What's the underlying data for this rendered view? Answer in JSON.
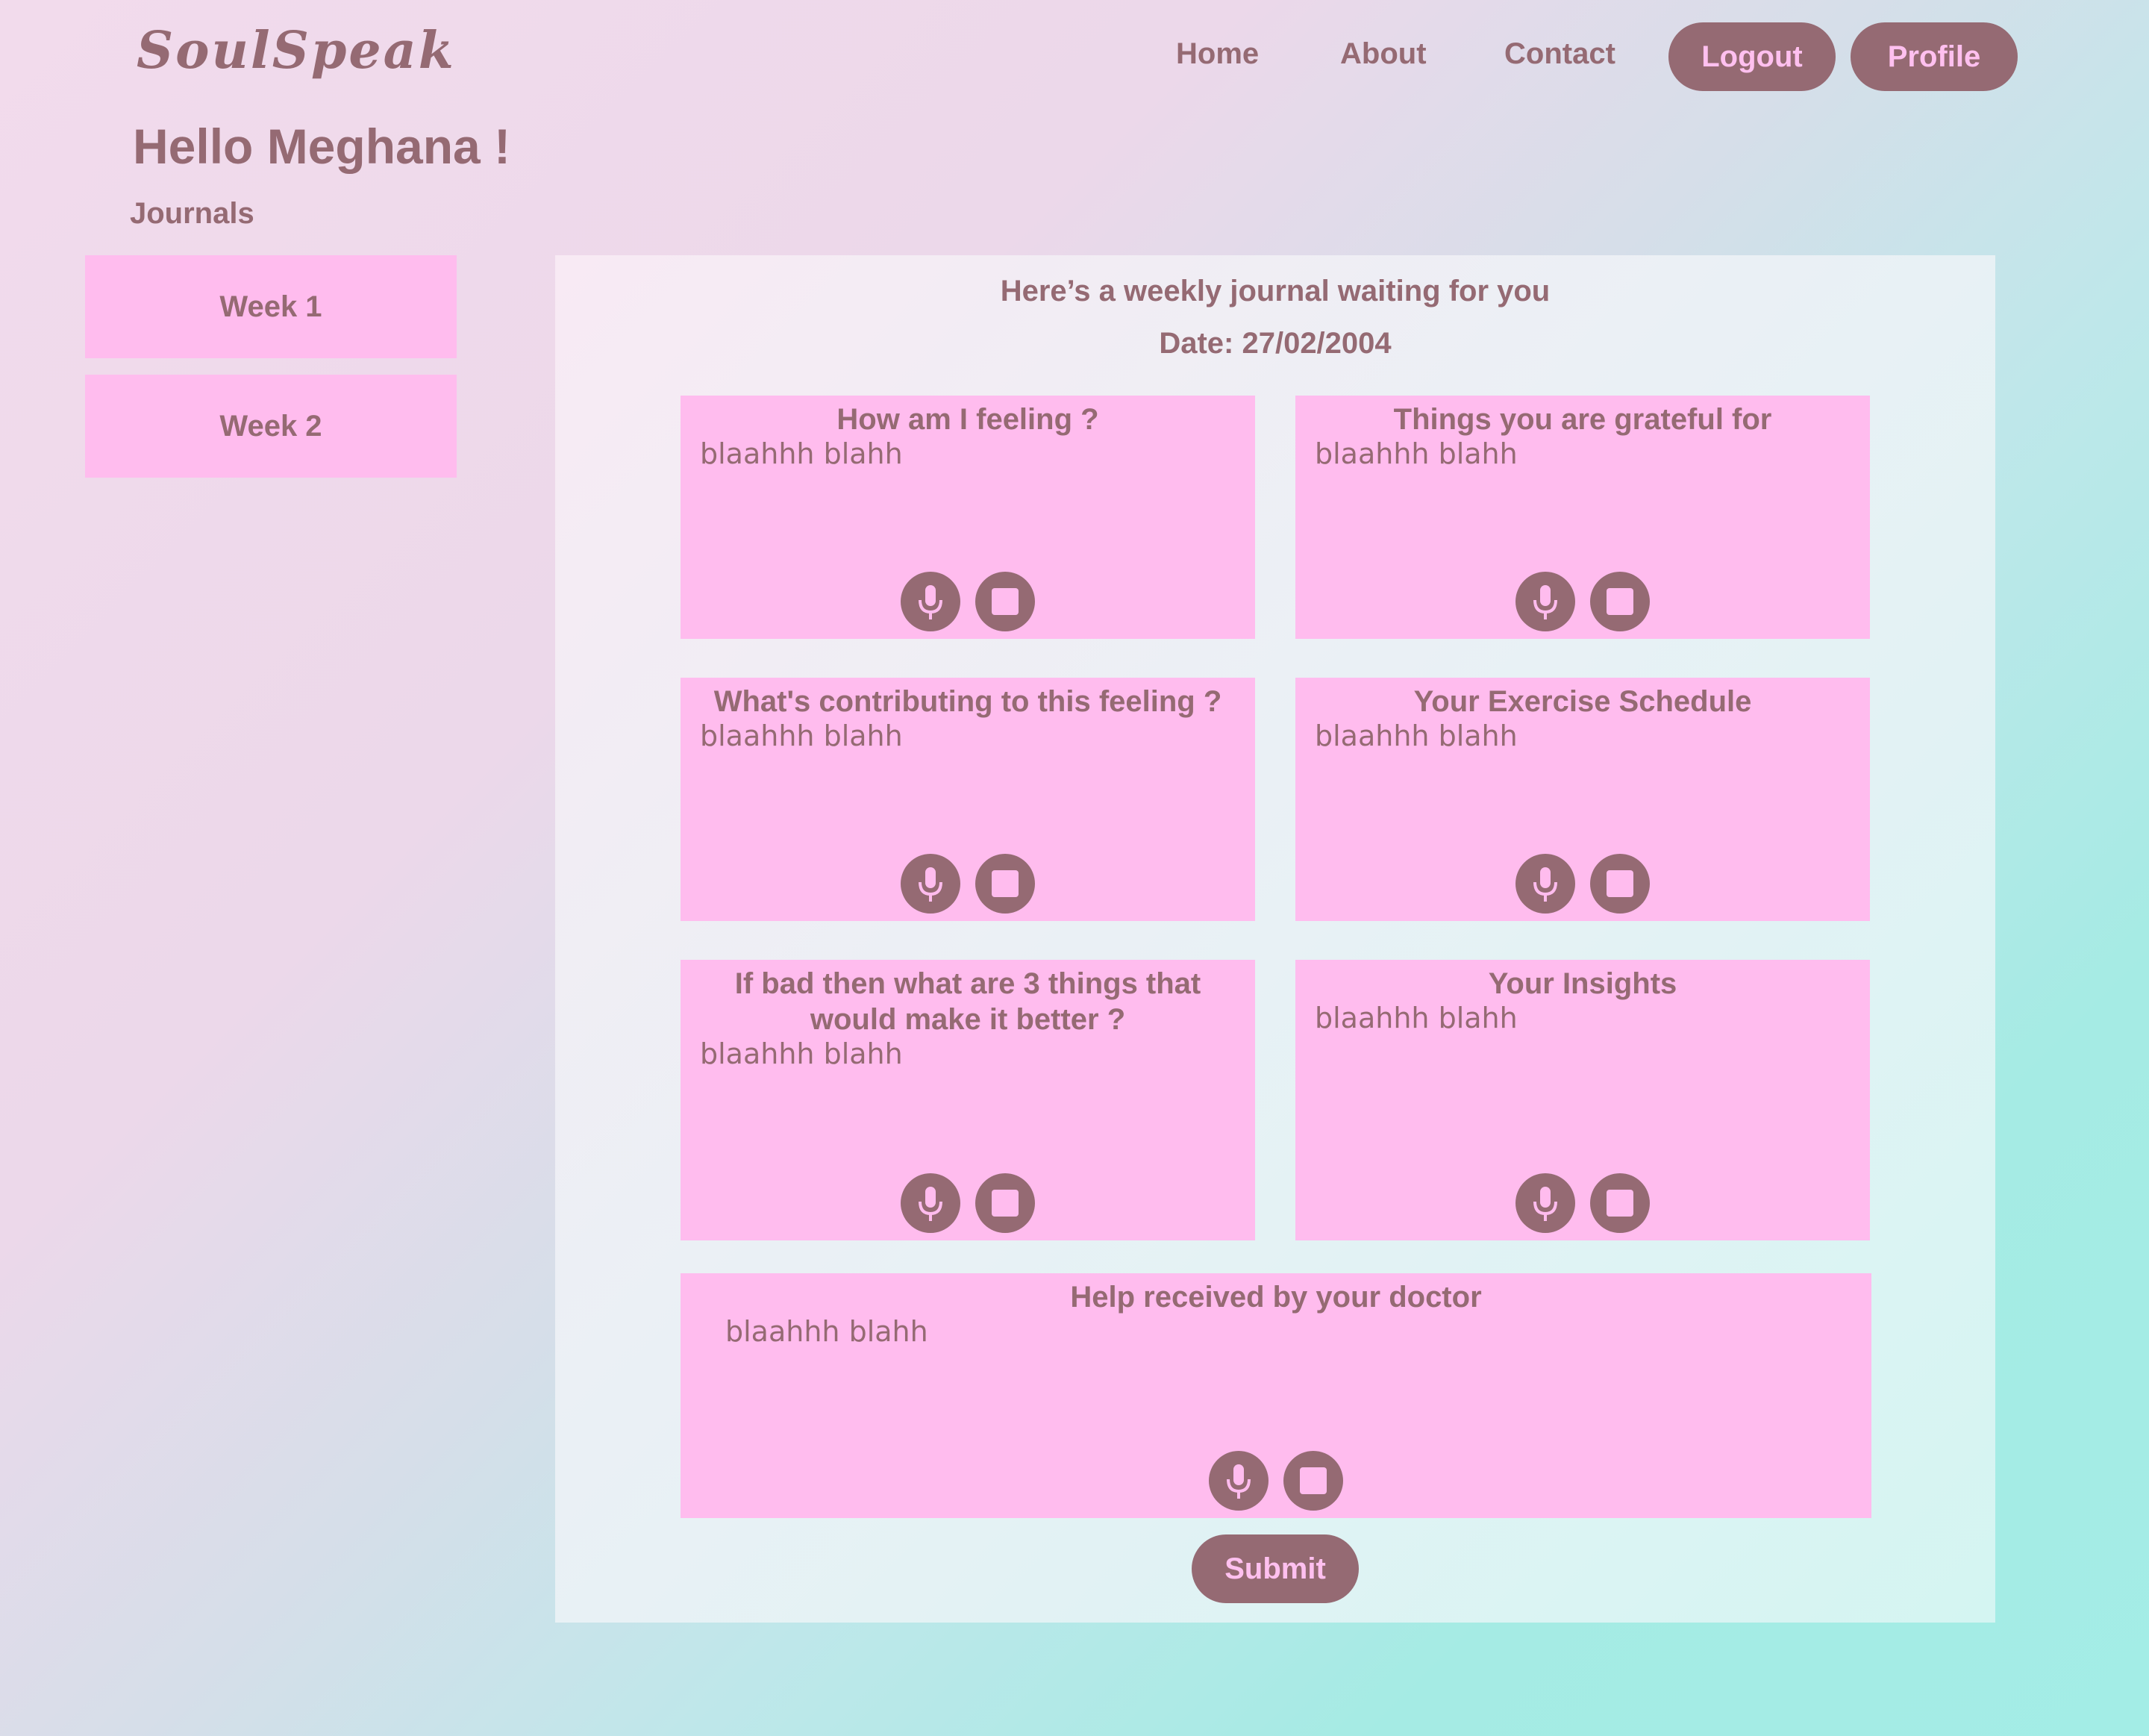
{
  "header": {
    "logo": "SoulSpeak",
    "nav": {
      "home": "Home",
      "about": "About",
      "contact": "Contact",
      "logout": "Logout",
      "profile": "Profile"
    }
  },
  "greeting": "Hello Meghana !",
  "sidebar": {
    "label": "Journals",
    "items": [
      "Week 1",
      "Week 2"
    ]
  },
  "journal": {
    "heading": "Here’s a weekly journal waiting for you",
    "date": "Date: 27/02/2004",
    "cards": [
      {
        "title": "How am I feeling ?",
        "text": "blaahhh blahh"
      },
      {
        "title": "Things you are grateful for",
        "text": "blaahhh blahh"
      },
      {
        "title": "What's contributing to this feeling ?",
        "text": "blaahhh blahh"
      },
      {
        "title": "Your Exercise Schedule",
        "text": "blaahhh blahh"
      },
      {
        "title": "If bad then what are 3 things that would make it better ?",
        "text": "blaahhh blahh"
      },
      {
        "title": "Your Insights",
        "text": "blaahhh blahh"
      },
      {
        "title": "Help received by your doctor",
        "text": "blaahhh blahh"
      }
    ],
    "icons": {
      "record": "microphone-icon",
      "stop": "stop-icon"
    },
    "submit": "Submit"
  },
  "colors": {
    "accent": "#956a73",
    "card": "#ffbcee",
    "button_text": "#ffc0ef"
  }
}
